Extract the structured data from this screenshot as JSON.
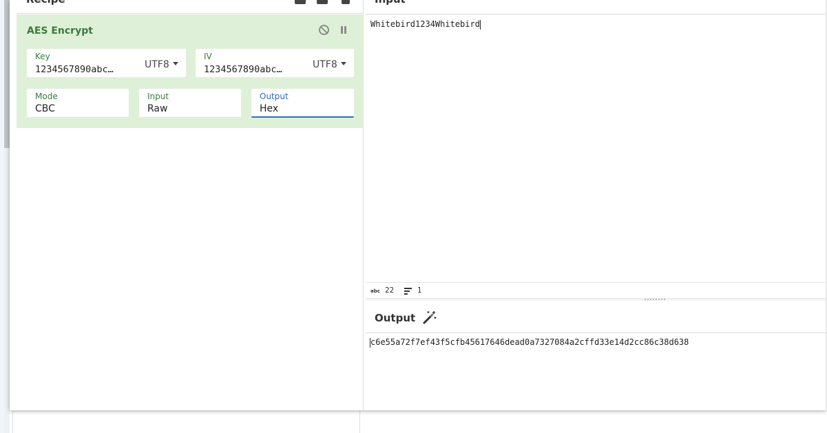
{
  "recipe": {
    "title": "Recipe",
    "operation": {
      "name": "AES Encrypt",
      "key": {
        "label": "Key",
        "value": "1234567890abc…",
        "encoding": "UTF8"
      },
      "iv": {
        "label": "IV",
        "value": "1234567890abc…",
        "encoding": "UTF8"
      },
      "mode": {
        "label": "Mode",
        "value": "CBC"
      },
      "input": {
        "label": "Input",
        "value": "Raw"
      },
      "output": {
        "label": "Output",
        "value": "Hex"
      }
    }
  },
  "input": {
    "title": "Input",
    "text": "Whitebird1234Whitebird",
    "status": {
      "abc_label": "abc",
      "length": "22",
      "lines": "1"
    }
  },
  "output": {
    "title": "Output",
    "text": "c6e55a72f7ef43f5cfb45617646dead0a7327084a2cffd33e14d2cc86c38d638"
  },
  "colors": {
    "operation_bg": "#dff0d8",
    "operation_title": "#3c7a3c",
    "active_field": "#2d6cc0"
  },
  "icons": [
    "disable-icon",
    "pause-icon",
    "magic-wand-icon",
    "lines-icon",
    "save-icon",
    "folder-icon",
    "trash-icon"
  ]
}
